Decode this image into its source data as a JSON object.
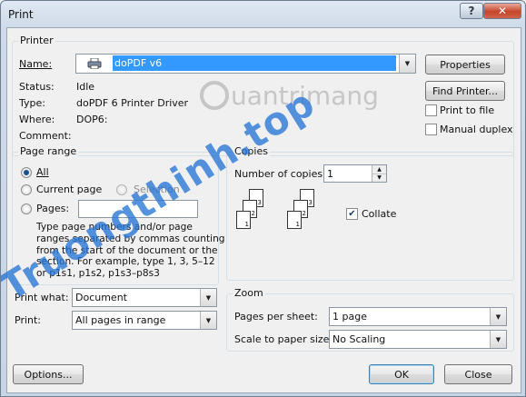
{
  "window": {
    "title": "Print",
    "help_label": "?",
    "close_label": "✕"
  },
  "printer": {
    "group_label": "Printer",
    "name_label": "Name:",
    "name_value": "doPDF v6",
    "status_label": "Status:",
    "status_value": "Idle",
    "type_label": "Type:",
    "type_value": "doPDF  6 Printer Driver",
    "where_label": "Where:",
    "where_value": "DOP6:",
    "comment_label": "Comment:",
    "properties_label": "Properties",
    "find_printer_label": "Find Printer...",
    "print_to_file_label": "Print to file",
    "print_to_file_checked": false,
    "manual_duplex_label": "Manual duplex",
    "manual_duplex_checked": false
  },
  "page_range": {
    "group_label": "Page range",
    "options": [
      {
        "label": "All",
        "selected": true,
        "enabled": true
      },
      {
        "label": "Current page",
        "selected": false,
        "enabled": true
      },
      {
        "label": "Selection",
        "selected": false,
        "enabled": false
      },
      {
        "label": "Pages:",
        "selected": false,
        "enabled": true
      }
    ],
    "pages_value": "",
    "help_lines": [
      "Type page numbers and/or page",
      "ranges separated by commas counting",
      "from the start of the document or the",
      "section. For example, type 1, 3, 5–12",
      "or p1s1, p1s2, p1s3–p8s3"
    ]
  },
  "copies": {
    "group_label": "Copies",
    "number_label": "Number of copies:",
    "number_value": "1",
    "collate_label": "Collate",
    "collate_checked": true,
    "page_numbers": [
      "3",
      "2",
      "1"
    ]
  },
  "print_what": {
    "label": "Print what:",
    "value": "Document"
  },
  "print": {
    "label": "Print:",
    "value": "All pages in range"
  },
  "zoom": {
    "group_label": "Zoom",
    "pages_per_sheet_label": "Pages per sheet:",
    "pages_per_sheet_value": "1 page",
    "scale_label": "Scale to paper size:",
    "scale_value": "No Scaling"
  },
  "buttons": {
    "options_label": "Options...",
    "ok_label": "OK",
    "close_label": "Close"
  },
  "watermarks": {
    "brand": "uantrimang",
    "overlay": "Truongthinh.top"
  }
}
